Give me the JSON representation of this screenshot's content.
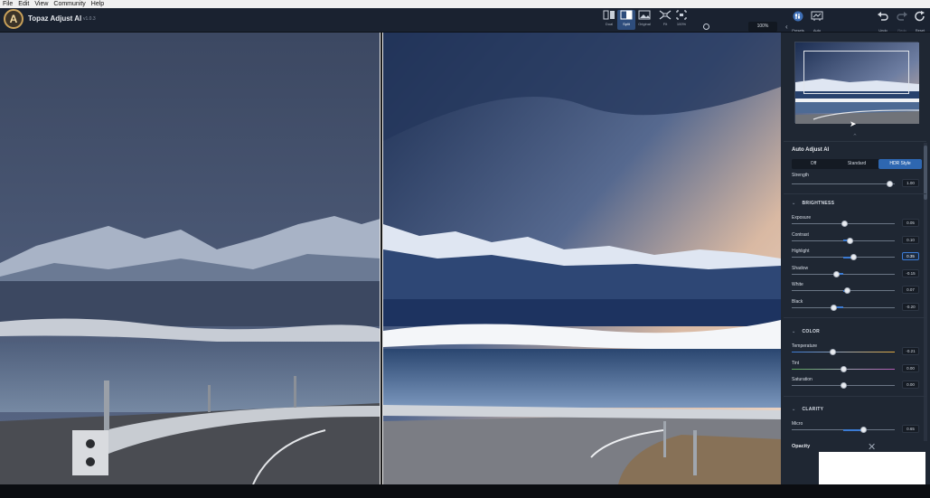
{
  "menu": [
    "File",
    "Edit",
    "View",
    "Community",
    "Help"
  ],
  "app": {
    "logo_letter": "A",
    "name": "Topaz Adjust AI",
    "version": "v1.0.3"
  },
  "view_modes": [
    {
      "icon": "dual-view-icon",
      "label": "Dual",
      "active": false
    },
    {
      "icon": "split-view-icon",
      "label": "Split",
      "active": true
    },
    {
      "icon": "original-view-icon",
      "label": "Original",
      "active": false
    },
    {
      "icon": "fit-icon",
      "label": "Fit",
      "active": false
    },
    {
      "icon": "zoom-100-icon",
      "label": "100%",
      "active": false
    }
  ],
  "zoom_value": "100%",
  "right_actions": [
    {
      "icon": "presets-icon",
      "label": "Presets",
      "enabled": true
    },
    {
      "icon": "auto-icon",
      "label": "Auto",
      "enabled": true
    },
    {
      "icon": "undo-icon",
      "label": "Undo",
      "enabled": true
    },
    {
      "icon": "redo-icon",
      "label": "Redo",
      "enabled": false
    },
    {
      "icon": "reset-icon",
      "label": "Reset",
      "enabled": true
    }
  ],
  "panel": {
    "auto_adjust": {
      "title": "Auto Adjust AI",
      "modes": [
        "Off",
        "Standard",
        "HDR Style"
      ],
      "active_mode": "HDR Style",
      "strength_label": "Strength",
      "strength_value": "1.00",
      "strength_level": 0.95
    },
    "sections": [
      {
        "title": "BRIGHTNESS",
        "sliders": [
          {
            "label": "Exposure",
            "value": "0.05",
            "level": 0.51
          },
          {
            "label": "Contrast",
            "value": "0.10",
            "level": 0.57
          },
          {
            "label": "Highlight",
            "value": "0.35",
            "level": 0.6,
            "focused": true
          },
          {
            "label": "Shadow",
            "value": "-0.15",
            "level": 0.43
          },
          {
            "label": "White",
            "value": "0.07",
            "level": 0.54
          },
          {
            "label": "Black",
            "value": "-0.20",
            "level": 0.41
          }
        ]
      },
      {
        "title": "COLOR",
        "sliders": [
          {
            "label": "Temperature",
            "value": "-0.21",
            "level": 0.4,
            "gradient": "temperature"
          },
          {
            "label": "Tint",
            "value": "0.00",
            "level": 0.5,
            "gradient": "tint"
          },
          {
            "label": "Saturation",
            "value": "0.00",
            "level": 0.5
          }
        ]
      },
      {
        "title": "CLARITY",
        "sliders": [
          {
            "label": "Micro",
            "value": "0.65",
            "level": 0.7
          }
        ]
      }
    ],
    "opacity_label": "Opacity"
  },
  "colors": {
    "accent": "#2e67b1",
    "panel_bg": "#1f2733",
    "topbar_bg": "#1a2230"
  }
}
